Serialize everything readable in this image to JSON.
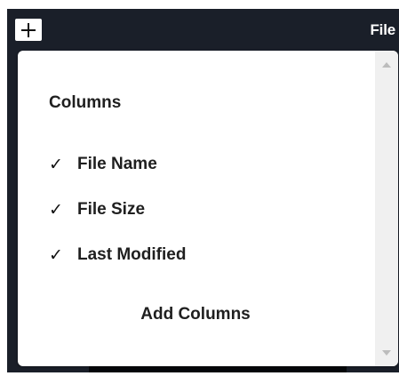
{
  "header": {
    "add_button_icon": "plus-icon",
    "label": "File"
  },
  "menu": {
    "heading": "Columns",
    "items": [
      {
        "label": "File Name",
        "checked": true,
        "check_glyph": "✓"
      },
      {
        "label": "File Size",
        "checked": true,
        "check_glyph": "✓"
      },
      {
        "label": "Last Modified",
        "checked": true,
        "check_glyph": "✓"
      }
    ],
    "add_columns_label": "Add Columns"
  },
  "colors": {
    "frame_background": "#1a1f29",
    "menu_background": "#ffffff",
    "scrollbar_track": "#f0f0f0"
  }
}
